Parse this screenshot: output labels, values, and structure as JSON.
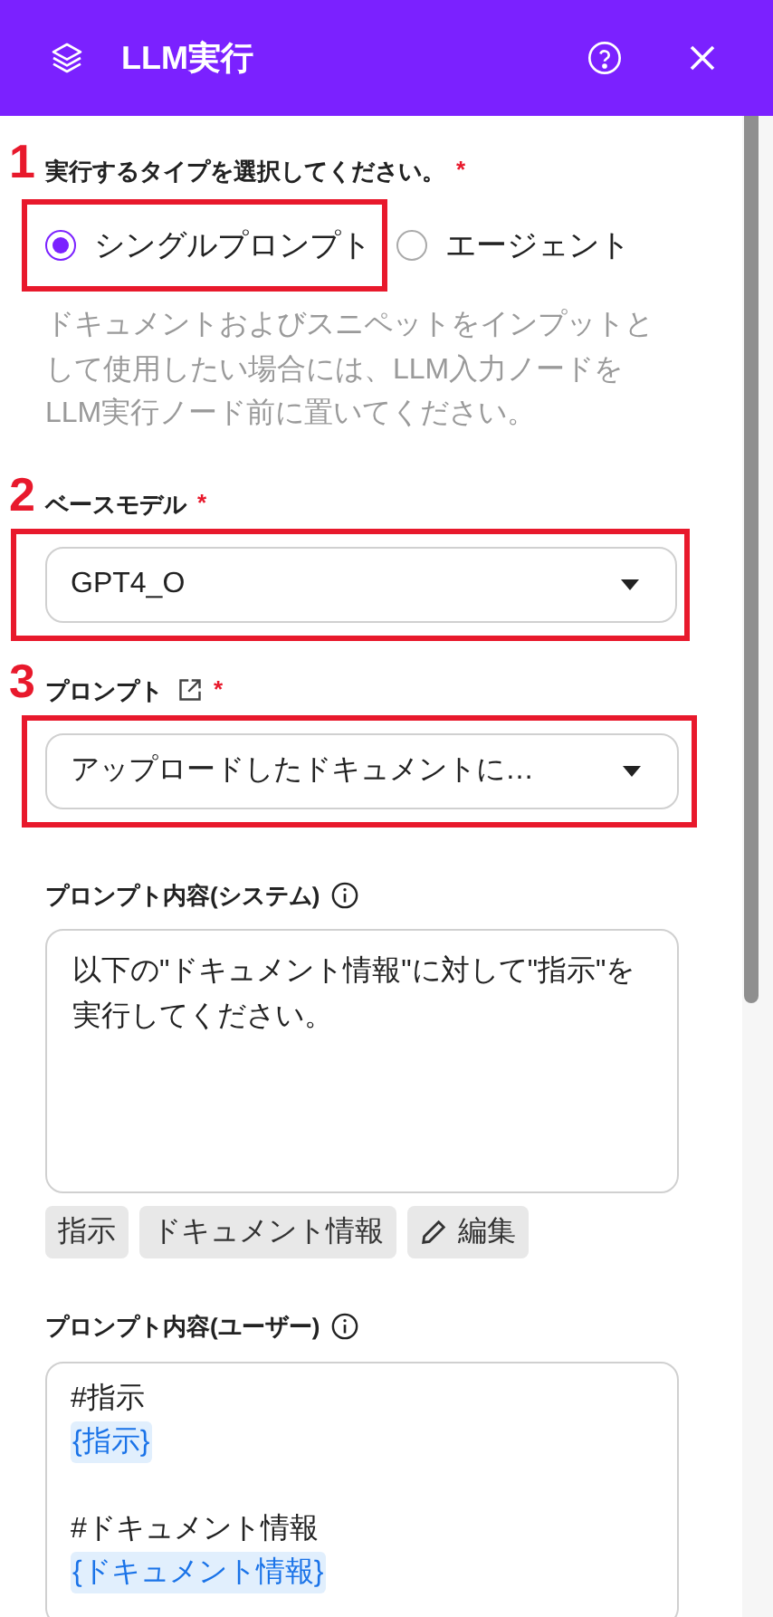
{
  "header": {
    "title": "LLM実行"
  },
  "execution_type": {
    "marker": "1",
    "label": "実行するタイプを選択してください。",
    "required_mark": "*",
    "options": [
      {
        "label": "シングルプロンプト",
        "selected": true,
        "highlighted": true
      },
      {
        "label": "エージェント",
        "selected": false,
        "highlighted": false
      }
    ],
    "help": "ドキュメントおよびスニペットをインプットとして使用したい場合には、LLM入力ノードをLLM実行ノード前に置いてください。"
  },
  "base_model": {
    "marker": "2",
    "label": "ベースモデル",
    "required_mark": "*",
    "value": "GPT4_O",
    "highlighted": true
  },
  "prompt": {
    "marker": "3",
    "label": "プロンプト",
    "required_mark": "*",
    "value": "アップロードしたドキュメントに…",
    "highlighted": true
  },
  "system_prompt": {
    "label": "プロンプト内容(システム)",
    "text": "以下の\"ドキュメント情報\"に対して\"指示\"を実行してください。",
    "chips": [
      {
        "kind": "variable",
        "label": "指示"
      },
      {
        "kind": "variable",
        "label": "ドキュメント情報"
      },
      {
        "kind": "edit",
        "label": "編集"
      }
    ]
  },
  "user_prompt": {
    "label": "プロンプト内容(ユーザー)",
    "blocks": [
      {
        "heading": "#指示",
        "variable": "{指示}"
      },
      {
        "heading": "#ドキュメント情報",
        "variable": "{ドキュメント情報}"
      }
    ]
  }
}
